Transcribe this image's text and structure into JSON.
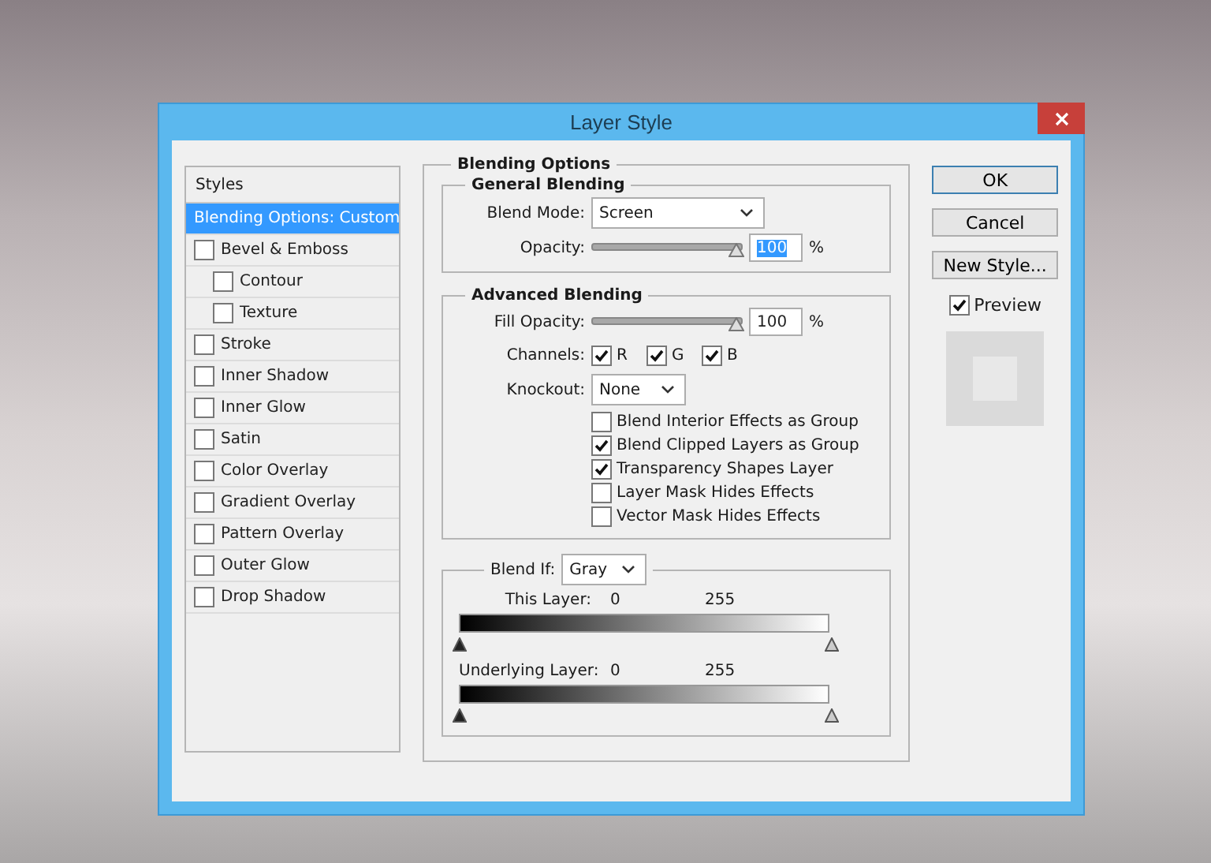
{
  "window": {
    "title": "Layer Style"
  },
  "styles": {
    "header": "Styles",
    "items": [
      {
        "label": "Blending Options: Custom",
        "kind": "plain",
        "selected": true
      },
      {
        "label": "Bevel & Emboss",
        "kind": "check",
        "checked": false,
        "selected": false,
        "children": [
          {
            "label": "Contour",
            "kind": "check",
            "checked": false,
            "selected": false
          },
          {
            "label": "Texture",
            "kind": "check",
            "checked": false,
            "selected": false
          }
        ]
      },
      {
        "label": "Stroke",
        "kind": "check",
        "checked": false,
        "selected": false
      },
      {
        "label": "Inner Shadow",
        "kind": "check",
        "checked": false,
        "selected": false
      },
      {
        "label": "Inner Glow",
        "kind": "check",
        "checked": false,
        "selected": false
      },
      {
        "label": "Satin",
        "kind": "check",
        "checked": false,
        "selected": false
      },
      {
        "label": "Color Overlay",
        "kind": "check",
        "checked": false,
        "selected": false
      },
      {
        "label": "Gradient Overlay",
        "kind": "check",
        "checked": false,
        "selected": false
      },
      {
        "label": "Pattern Overlay",
        "kind": "check",
        "checked": false,
        "selected": false
      },
      {
        "label": "Outer Glow",
        "kind": "check",
        "checked": false,
        "selected": false
      },
      {
        "label": "Drop Shadow",
        "kind": "check",
        "checked": false,
        "selected": false
      }
    ]
  },
  "blending": {
    "title": "Blending Options",
    "general": {
      "title": "General Blending",
      "blend_mode": {
        "label": "Blend Mode:",
        "value": "Screen"
      },
      "opacity": {
        "label": "Opacity:",
        "level": 1,
        "value": "100",
        "unit": "%",
        "highlighted": true
      }
    },
    "advanced": {
      "title": "Advanced Blending",
      "fill_opacity": {
        "label": "Fill Opacity:",
        "level": 1,
        "value": "100",
        "unit": "%",
        "highlighted": false
      },
      "channels": {
        "label": "Channels:",
        "items": [
          {
            "label": "R",
            "checked": true
          },
          {
            "label": "G",
            "checked": true
          },
          {
            "label": "B",
            "checked": true
          }
        ]
      },
      "knockout": {
        "label": "Knockout:",
        "value": "None"
      },
      "options": [
        {
          "label": "Blend Interior Effects as Group",
          "checked": false
        },
        {
          "label": "Blend Clipped Layers as Group",
          "checked": true
        },
        {
          "label": "Transparency Shapes Layer",
          "checked": true
        },
        {
          "label": "Layer Mask Hides Effects",
          "checked": false
        },
        {
          "label": "Vector Mask Hides Effects",
          "checked": false
        }
      ]
    },
    "blend_if": {
      "label": "Blend If:",
      "value": "Gray",
      "ranges": [
        {
          "label": "This Layer:",
          "low": "0",
          "high": "255"
        },
        {
          "label": "Underlying Layer:",
          "low": "0",
          "high": "255"
        }
      ]
    }
  },
  "buttons": [
    {
      "label": "OK",
      "default": true
    },
    {
      "label": "Cancel",
      "default": false
    },
    {
      "label": "New Style...",
      "default": false
    }
  ],
  "preview": {
    "label": "Preview",
    "checked": true
  }
}
